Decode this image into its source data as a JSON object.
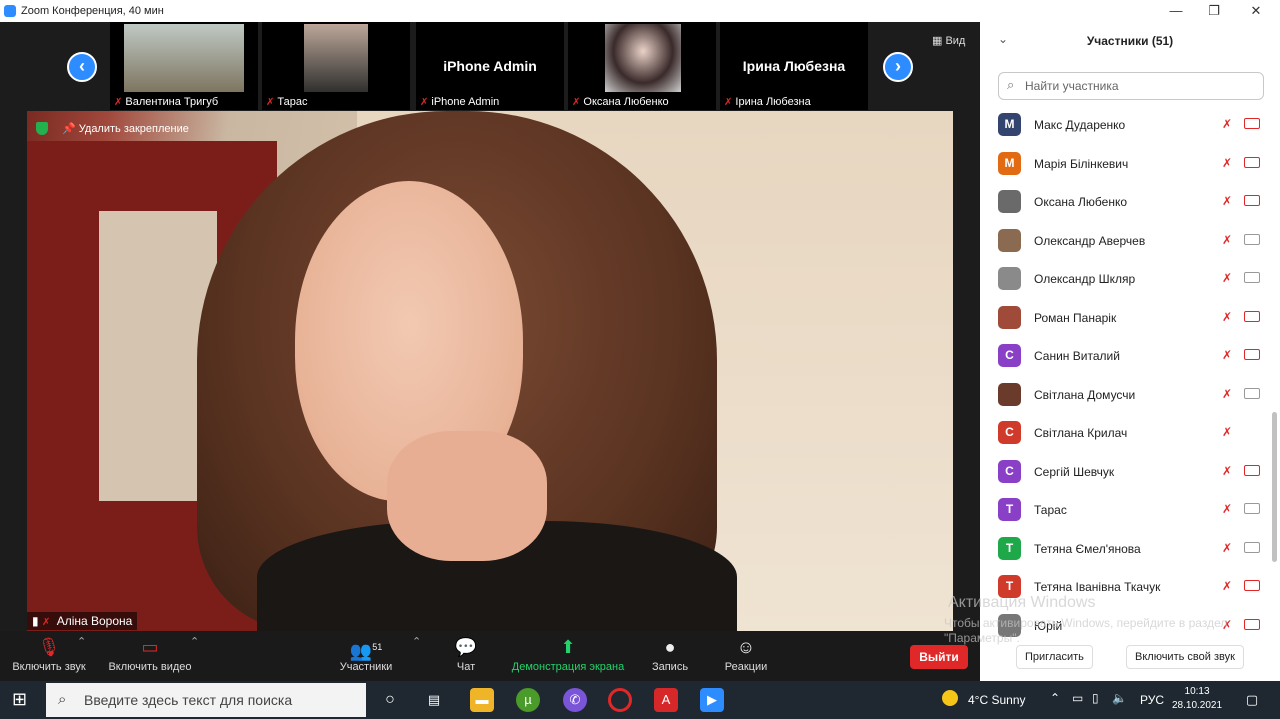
{
  "window": {
    "title": "Zoom Конференция, 40 мин"
  },
  "strip": {
    "prev": "‹",
    "next": "›",
    "view_label": "Вид",
    "thumbs": [
      {
        "caption": "Валентина Тригуб",
        "big_name": ""
      },
      {
        "caption": "Тарас",
        "big_name": ""
      },
      {
        "caption": "iPhone Admin",
        "big_name": "iPhone Admin"
      },
      {
        "caption": "Оксана Любенко",
        "big_name": ""
      },
      {
        "caption": "Ірина Любезна",
        "big_name": "Ірина Любезна"
      }
    ]
  },
  "video": {
    "unpin_label": "Удалить закрепление",
    "speaker_name": "Аліна Ворона"
  },
  "toolbar": {
    "mute": "Включить звук",
    "video": "Включить видео",
    "participants": "Участники",
    "participants_count": "51",
    "chat": "Чат",
    "share": "Демонстрация экрана",
    "record": "Запись",
    "reactions": "Реакции",
    "leave": "Выйти"
  },
  "panel": {
    "title": "Участники (51)",
    "search_placeholder": "Найти участника",
    "participants": [
      {
        "name": "Макс Дударенко",
        "initial": "М",
        "color": "#33456e",
        "video": "off"
      },
      {
        "name": "Марія Білінкевич",
        "initial": "М",
        "color": "#e26a12",
        "video": "off"
      },
      {
        "name": "Оксана Любенко",
        "initial": "",
        "color": "#6a6a6a",
        "video": "off"
      },
      {
        "name": "Олександр Аверчев",
        "initial": "",
        "color": "#8a6a50",
        "video": "on"
      },
      {
        "name": "Олександр Шкляр",
        "initial": "",
        "color": "#8a8a8a",
        "video": "on"
      },
      {
        "name": "Роман Панарік",
        "initial": "",
        "color": "#a04a3a",
        "video": "off"
      },
      {
        "name": "Санин Виталий",
        "initial": "С",
        "color": "#8a3fc7",
        "video": "off"
      },
      {
        "name": "Світлана Домусчи",
        "initial": "",
        "color": "#6a3a2a",
        "video": "on"
      },
      {
        "name": "Світлана Крилач",
        "initial": "С",
        "color": "#d03a2a",
        "video": "none"
      },
      {
        "name": "Сергій Шевчук",
        "initial": "С",
        "color": "#8a3fc7",
        "video": "off"
      },
      {
        "name": "Тарас",
        "initial": "Т",
        "color": "#8a3fc7",
        "video": "on"
      },
      {
        "name": "Тетяна Ємел'янова",
        "initial": "Т",
        "color": "#1fa84a",
        "video": "on"
      },
      {
        "name": "Тетяна Іванівна Ткачук",
        "initial": "Т",
        "color": "#d03a2a",
        "video": "off"
      },
      {
        "name": "Юрій",
        "initial": "",
        "color": "#777777",
        "video": "off"
      }
    ],
    "invite": "Пригласить",
    "unmute_me": "Включить свой звук"
  },
  "watermark": {
    "line1": "Активация Windows",
    "line2": "Чтобы активировать Windows, перейдите в раздел \"Параметры\"."
  },
  "taskbar": {
    "search_placeholder": "Введите здесь текст для поиска",
    "weather": "4°C  Sunny",
    "lang": "РУС",
    "time": "10:13",
    "date": "28.10.2021"
  }
}
